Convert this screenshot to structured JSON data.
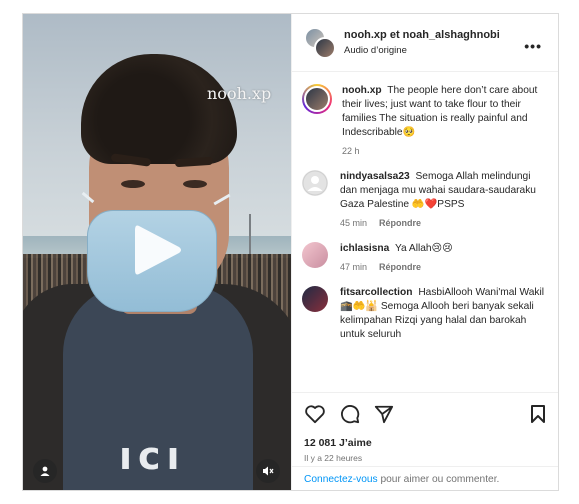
{
  "media": {
    "watermark": "nooh.xp",
    "play_icon": "play-icon",
    "user_tag_icon": "user-icon",
    "mute_icon": "muted-speaker-icon"
  },
  "header": {
    "names": "nooh.xp et noah_alshaghnobi",
    "audio": "Audio d’origine",
    "more_icon": "more-icon"
  },
  "caption": {
    "username": "nooh.xp",
    "text": "The people here don’t care about their lives; just want to take flour to their families The situation is really painful and Indescribable🥺",
    "time": "22 h"
  },
  "comments": [
    {
      "username": "nindyasalsa23",
      "text": "Semoga Allah melindungi dan menjaga mu wahai saudara-saudaraku Gaza Palestine 🤲❤️PSPS",
      "time": "45 min",
      "reply": "Répondre"
    },
    {
      "username": "ichlasisna",
      "text": "Ya Allah😢😢",
      "time": "47 min",
      "reply": "Répondre"
    },
    {
      "username": "fitsarcollection",
      "text": "HasbiAllooh Wani'mal Wakil 🕋🤲🕌 Semoga Allooh beri banyak sekali kelimpahan Rizqi yang halal dan barokah untuk seluruh",
      "time": "",
      "reply": ""
    }
  ],
  "actions": {
    "like_icon": "heart-icon",
    "comment_icon": "comment-icon",
    "share_icon": "share-icon",
    "save_icon": "bookmark-icon",
    "likes": "12 081 J’aime",
    "posted": "Il y a 22 heures"
  },
  "login": {
    "link": "Connectez-vous",
    "rest": " pour aimer ou commenter."
  }
}
